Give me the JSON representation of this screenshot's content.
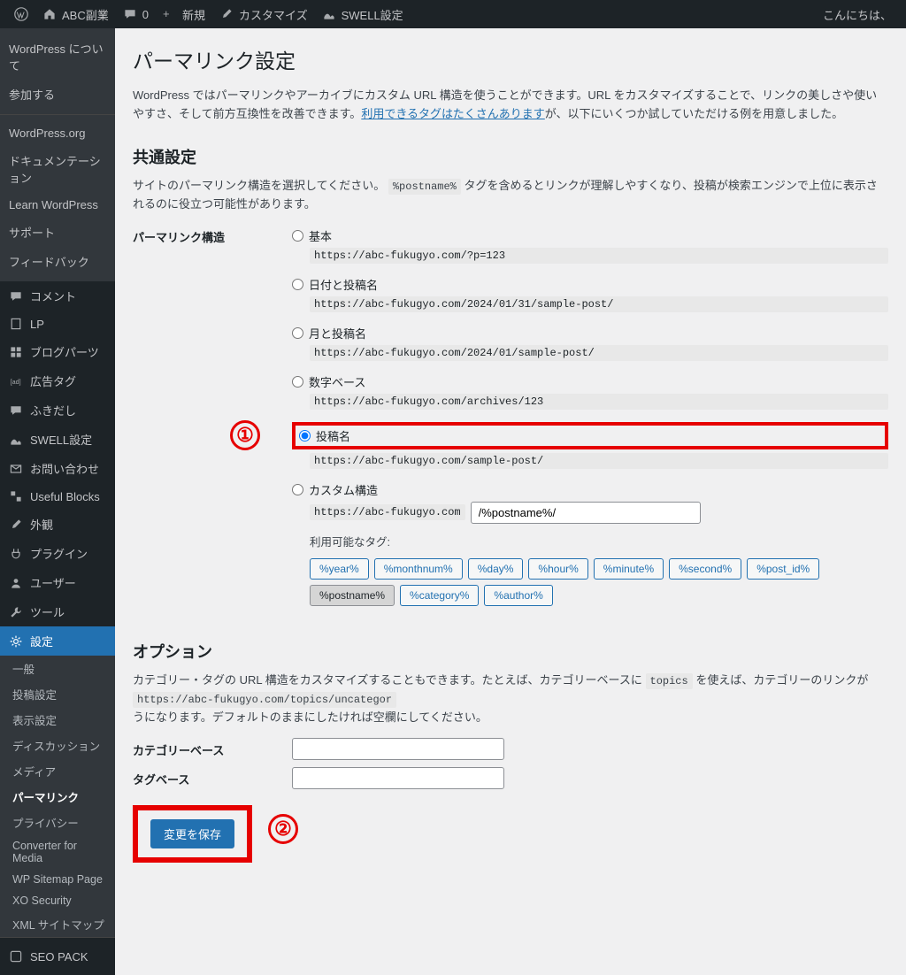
{
  "adminbar": {
    "site": "ABC副業",
    "comments": "0",
    "new": "新規",
    "customize": "カスタマイズ",
    "swell": "SWELL設定",
    "greeting": "こんにちは、"
  },
  "sidebar": {
    "upper": [
      "WordPress について",
      "参加する"
    ],
    "links": [
      "WordPress.org",
      "ドキュメンテーション",
      "Learn WordPress",
      "サポート",
      "フィードバック"
    ],
    "menu": [
      {
        "icon": "comment",
        "label": "コメント"
      },
      {
        "icon": "page",
        "label": "LP"
      },
      {
        "icon": "grid",
        "label": "ブログパーツ"
      },
      {
        "icon": "ad",
        "label": "広告タグ"
      },
      {
        "icon": "chat",
        "label": "ふきだし"
      },
      {
        "icon": "swell",
        "label": "SWELL設定"
      },
      {
        "icon": "mail",
        "label": "お問い合わせ"
      },
      {
        "icon": "blocks",
        "label": "Useful Blocks"
      },
      {
        "icon": "brush",
        "label": "外観"
      },
      {
        "icon": "plug",
        "label": "プラグイン"
      },
      {
        "icon": "user",
        "label": "ユーザー"
      },
      {
        "icon": "tool",
        "label": "ツール"
      },
      {
        "icon": "gear",
        "label": "設定",
        "current": true
      }
    ],
    "sub": [
      {
        "label": "一般"
      },
      {
        "label": "投稿設定"
      },
      {
        "label": "表示設定"
      },
      {
        "label": "ディスカッション"
      },
      {
        "label": "メディア"
      },
      {
        "label": "パーマリンク",
        "current": true
      },
      {
        "label": "プライバシー"
      },
      {
        "label": "Converter for Media"
      },
      {
        "label": "WP Sitemap Page"
      },
      {
        "label": "XO Security"
      },
      {
        "label": "XML サイトマップ"
      }
    ],
    "seopack": "SEO PACK"
  },
  "page": {
    "title": "パーマリンク設定",
    "intro_a": "WordPress ではパーマリンクやアーカイブにカスタム URL 構造を使うことができます。URL をカスタマイズすることで、リンクの美しさや使いやすさ、そして前方互換性を改善できます。",
    "intro_link": "利用できるタグはたくさんあります",
    "intro_b": "が、以下にいくつか試していただける例を用意しました。",
    "h2_common": "共通設定",
    "common_desc_a": "サイトのパーマリンク構造を選択してください。",
    "common_code": "%postname%",
    "common_desc_b": " タグを含めるとリンクが理解しやすくなり、投稿が検索エンジンで上位に表示されるのに役立つ可能性があります。",
    "structure_label": "パーマリンク構造",
    "options": [
      {
        "label": "基本",
        "url": "https://abc-fukugyo.com/?p=123"
      },
      {
        "label": "日付と投稿名",
        "url": "https://abc-fukugyo.com/2024/01/31/sample-post/"
      },
      {
        "label": "月と投稿名",
        "url": "https://abc-fukugyo.com/2024/01/sample-post/"
      },
      {
        "label": "数字ベース",
        "url": "https://abc-fukugyo.com/archives/123"
      },
      {
        "label": "投稿名",
        "url": "https://abc-fukugyo.com/sample-post/",
        "checked": true,
        "highlight": true
      },
      {
        "label": "カスタム構造"
      }
    ],
    "custom_prefix": "https://abc-fukugyo.com",
    "custom_value": "/%postname%/",
    "tags_label": "利用可能なタグ:",
    "tags": [
      "%year%",
      "%monthnum%",
      "%day%",
      "%hour%",
      "%minute%",
      "%second%",
      "%post_id%",
      "%postname%",
      "%category%",
      "%author%"
    ],
    "tag_selected": "%postname%",
    "h2_options": "オプション",
    "options_desc_a": "カテゴリー・タグの URL 構造をカスタマイズすることもできます。たとえば、カテゴリーベースに ",
    "options_code1": "topics",
    "options_desc_b": " を使えば、カテゴリーのリンクが ",
    "options_code2": "https://abc-fukugyo.com/topics/uncategor",
    "options_desc_c": "うになります。デフォルトのままにしたければ空欄にしてください。",
    "cat_base": "カテゴリーベース",
    "tag_base": "タグベース",
    "save": "変更を保存",
    "anno1": "①",
    "anno2": "②"
  }
}
